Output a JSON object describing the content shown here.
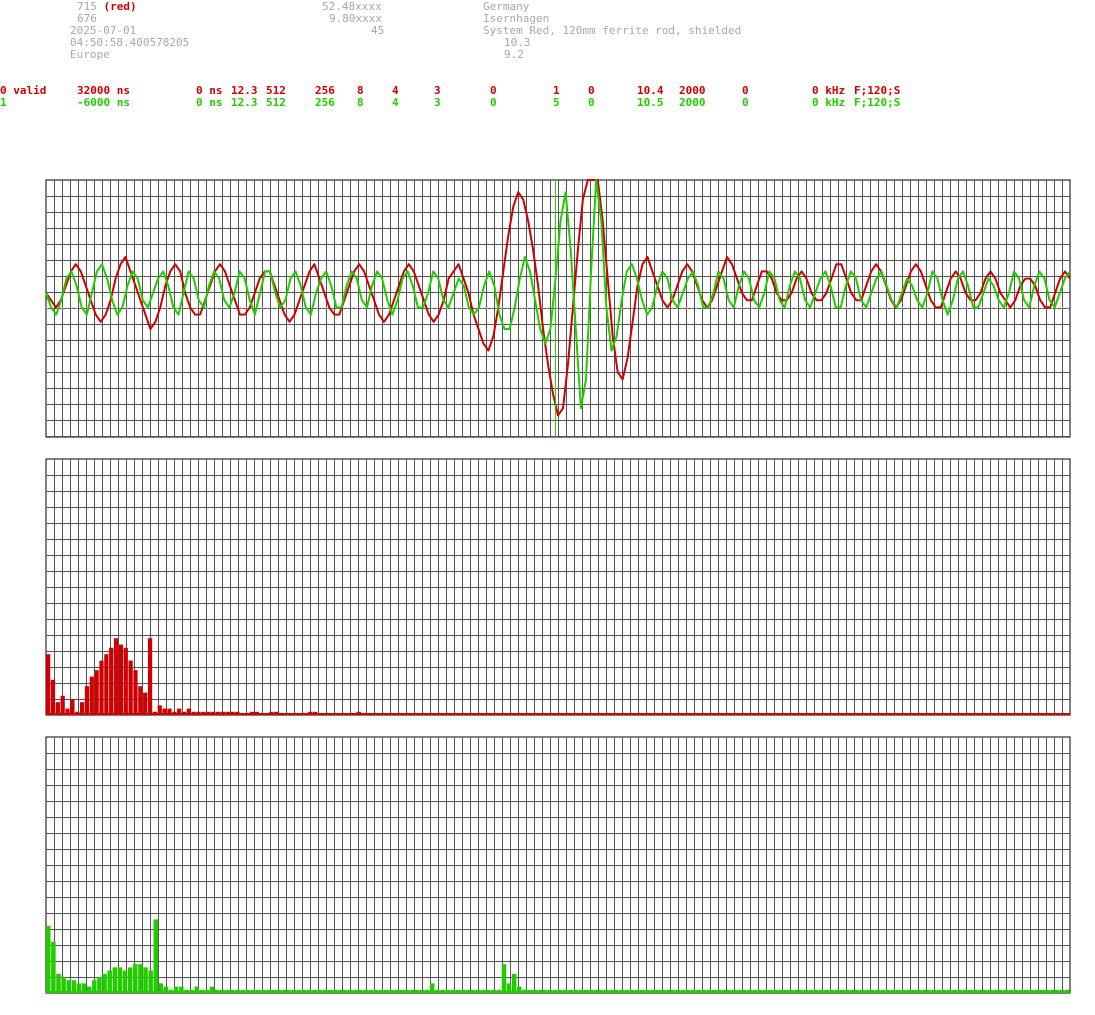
{
  "header": {
    "col1": [
      "715",
      "676",
      "2025-07-01",
      "04:50:58.400578205",
      "Europe"
    ],
    "col1_suffix": "(red)",
    "col2": [
      "52.48xxxx",
      "9.80xxxx",
      "45"
    ],
    "col3": [
      "Germany",
      "Isernhagen",
      "System Red, 120mm ferrite rod, shielded"
    ],
    "col3_extra": [
      "10.3",
      "9.2"
    ]
  },
  "channels": [
    {
      "color": "#d00000",
      "cells": [
        "0 valid",
        "32000 ns",
        "0 ns",
        "12.3",
        "512",
        "256",
        "8",
        "4",
        "3",
        "0",
        "1",
        "0",
        "10.4",
        "2000",
        "0",
        "0 kHz",
        "F;120;S"
      ]
    },
    {
      "color": "#22cc00",
      "cells": [
        "1",
        "-6000 ns",
        "0 ns",
        "12.3",
        "512",
        "256",
        "8",
        "4",
        "3",
        "0",
        "5",
        "0",
        "10.5",
        "2000",
        "0",
        "0 kHz",
        "F;120;S"
      ]
    }
  ],
  "chart_data": [
    {
      "type": "line",
      "series": [
        {
          "color": "#d00000",
          "values": [
            0,
            -1,
            -2,
            -1,
            1,
            3,
            4,
            3,
            1,
            -1,
            -3,
            -4,
            -3,
            -1,
            2,
            4,
            5,
            3,
            1,
            -1,
            -3,
            -5,
            -4,
            -2,
            1,
            3,
            4,
            3,
            0,
            -2,
            -3,
            -3,
            -1,
            1,
            3,
            4,
            3,
            1,
            -1,
            -3,
            -3,
            -2,
            0,
            2,
            3,
            3,
            1,
            -1,
            -3,
            -4,
            -3,
            -1,
            1,
            3,
            4,
            2,
            0,
            -2,
            -3,
            -3,
            -1,
            1,
            3,
            4,
            3,
            1,
            -1,
            -3,
            -4,
            -3,
            -1,
            1,
            3,
            4,
            3,
            1,
            -1,
            -3,
            -4,
            -3,
            -1,
            2,
            3,
            4,
            2,
            0,
            -3,
            -5,
            -7,
            -8,
            -6,
            -2,
            3,
            8,
            12,
            14,
            13,
            10,
            6,
            1,
            -5,
            -10,
            -14,
            -17,
            -16,
            -10,
            -2,
            6,
            13,
            17,
            18,
            16,
            10,
            2,
            -6,
            -11,
            -12,
            -9,
            -4,
            1,
            4,
            5,
            3,
            1,
            -1,
            -2,
            -1,
            1,
            3,
            4,
            3,
            1,
            -1,
            -2,
            -1,
            1,
            3,
            5,
            4,
            2,
            0,
            -1,
            -1,
            1,
            3,
            3,
            2,
            0,
            -1,
            -1,
            0,
            2,
            3,
            2,
            0,
            -1,
            -1,
            0,
            2,
            4,
            4,
            2,
            0,
            -1,
            -1,
            1,
            3,
            4,
            3,
            1,
            -1,
            -2,
            -1,
            1,
            3,
            4,
            3,
            1,
            -1,
            -2,
            -2,
            0,
            2,
            3,
            2,
            0,
            -1,
            -1,
            0,
            2,
            3,
            2,
            0,
            -1,
            -2,
            -1,
            1,
            2,
            2,
            1,
            -1,
            -2,
            -2,
            0,
            2,
            3,
            2
          ]
        },
        {
          "color": "#22cc00",
          "values": [
            0,
            -2,
            -3,
            -1,
            2,
            3,
            1,
            -2,
            -3,
            0,
            3,
            4,
            2,
            -1,
            -3,
            -2,
            1,
            3,
            2,
            -1,
            -2,
            0,
            2,
            3,
            1,
            -2,
            -3,
            0,
            3,
            2,
            -1,
            -2,
            1,
            3,
            2,
            -1,
            -2,
            0,
            3,
            2,
            -1,
            -3,
            0,
            3,
            3,
            0,
            -2,
            -1,
            2,
            3,
            1,
            -2,
            -3,
            0,
            2,
            3,
            1,
            -2,
            -2,
            1,
            3,
            2,
            -1,
            -2,
            1,
            3,
            2,
            -1,
            -3,
            -1,
            2,
            3,
            1,
            -2,
            -2,
            0,
            3,
            2,
            -1,
            -2,
            0,
            2,
            1,
            -2,
            -3,
            -2,
            1,
            3,
            1,
            -3,
            -5,
            -5,
            -2,
            2,
            5,
            3,
            -1,
            -5,
            -7,
            -5,
            2,
            10,
            14,
            6,
            -5,
            -16,
            -12,
            3,
            16,
            10,
            -2,
            -8,
            -6,
            -1,
            3,
            4,
            2,
            -1,
            -3,
            -2,
            1,
            3,
            2,
            -1,
            -2,
            0,
            2,
            3,
            1,
            -2,
            -2,
            0,
            3,
            2,
            -1,
            -2,
            1,
            3,
            2,
            -1,
            -2,
            0,
            3,
            2,
            -1,
            -2,
            1,
            3,
            2,
            -1,
            -2,
            0,
            2,
            3,
            1,
            -2,
            -2,
            1,
            3,
            2,
            -1,
            -2,
            0,
            2,
            3,
            1,
            -1,
            -2,
            0,
            2,
            1,
            -1,
            -2,
            0,
            3,
            2,
            -1,
            -3,
            -1,
            2,
            3,
            1,
            -2,
            -2,
            0,
            2,
            1,
            -1,
            -2,
            0,
            3,
            2,
            -1,
            -2,
            1,
            3,
            2,
            -1,
            -2,
            0,
            2,
            3
          ]
        }
      ]
    },
    {
      "type": "bar",
      "series": [
        {
          "color": "#d00000",
          "values": [
            19,
            11,
            4,
            6,
            2,
            5,
            1,
            4,
            9,
            12,
            14,
            17,
            19,
            21,
            24,
            22,
            21,
            17,
            14,
            9,
            7,
            24,
            1,
            3,
            2,
            2,
            1,
            2,
            1,
            2,
            1,
            1,
            1,
            1,
            1,
            1,
            1,
            1,
            1,
            1,
            0.5,
            0.5,
            1,
            1,
            0.5,
            0.5,
            1,
            1,
            0.5,
            0.5,
            0.5,
            0.5,
            0.5,
            0.5,
            1,
            1,
            0.5,
            0.5,
            0.5,
            0.5,
            0.5,
            0.5,
            0.5,
            0.5,
            1,
            0.5,
            0.5,
            0.5,
            0.5,
            0.5,
            0.5,
            0.5,
            0.5,
            0.5,
            0.5,
            0.5,
            0.5,
            0.5,
            0.5,
            0.5,
            0.5,
            0.5,
            0.5,
            0.5,
            0.5,
            0.5,
            0.5,
            0.5,
            0.5,
            0.5,
            0.5,
            0.5,
            0.5,
            0.5,
            0.5,
            0.5,
            0.5,
            0.5,
            0.5,
            0.5,
            0.5,
            0.5,
            0.5,
            0.5,
            0.5,
            0.5,
            0.5,
            0.5,
            0.5,
            0.5,
            0.5,
            0.5,
            0.5,
            0.5,
            0.5,
            0.5,
            0.5,
            0.5,
            0.5,
            0.5,
            0.5,
            0.5,
            0.5,
            0.5,
            0.5,
            0.5,
            0.5,
            0.5,
            0.5,
            0.5,
            0.5,
            0.5,
            0.5,
            0.5,
            0.5,
            0.5,
            0.5,
            0.5,
            0.5,
            0.5,
            0.5,
            0.5,
            0.5,
            0.5,
            0.5,
            0.5,
            0.5,
            0.5,
            0.5,
            0.5,
            0.5,
            0.5,
            0.5,
            0.5,
            0.5,
            0.5,
            0.5,
            0.5,
            0.5,
            0.5,
            0.5,
            0.5,
            0.5,
            0.5,
            0.5,
            0.5,
            0.5,
            0.5,
            0.5,
            0.5,
            0.5,
            0.5,
            0.5,
            0.5,
            0.5,
            0.5,
            0.5,
            0.5,
            0.5,
            0.5,
            0.5,
            0.5,
            0.5,
            0.5,
            0.5,
            0.5,
            0.5,
            0.5,
            0.5,
            0.5,
            0.5,
            0.5,
            0.5,
            0.5,
            0.5,
            0.5,
            0.5,
            0.5,
            0.5,
            0.5,
            0.5,
            0.5,
            0.5,
            0.5,
            0.5,
            0.5,
            0.5,
            0.5,
            0.5,
            0.5,
            0.5
          ]
        }
      ]
    },
    {
      "type": "bar",
      "series": [
        {
          "color": "#22cc00",
          "values": [
            21,
            16,
            6,
            5,
            4,
            4,
            3,
            3,
            2,
            4,
            5,
            6,
            7,
            8,
            8,
            7,
            8,
            9,
            9,
            8,
            7,
            23,
            3,
            2,
            1,
            2,
            2,
            1,
            1,
            2,
            1,
            1,
            2,
            1,
            1,
            1,
            1,
            1,
            1,
            1,
            1,
            1,
            1,
            1,
            1,
            1,
            1,
            1,
            1,
            1,
            1,
            1,
            1,
            1,
            1,
            1,
            1,
            1,
            1,
            1,
            1,
            1,
            1,
            1,
            1,
            1,
            1,
            1,
            1,
            1,
            1,
            1,
            1,
            1,
            1,
            3,
            1,
            1,
            1,
            1,
            1,
            1,
            1,
            1,
            1,
            1,
            1,
            1,
            1,
            9,
            3,
            6,
            2,
            1,
            1,
            1,
            1,
            1,
            1,
            1,
            1,
            1,
            1,
            1,
            1,
            1,
            1,
            1,
            1,
            1,
            1,
            1,
            1,
            1,
            1,
            1,
            1,
            1,
            1,
            1,
            1,
            1,
            1,
            1,
            1,
            1,
            1,
            1,
            1,
            1,
            1,
            1,
            1,
            1,
            1,
            1,
            1,
            1,
            1,
            1,
            1,
            1,
            1,
            1,
            1,
            1,
            1,
            1,
            1,
            1,
            1,
            1,
            1,
            1,
            1,
            1,
            1,
            1,
            1,
            1,
            1,
            1,
            1,
            1,
            1,
            1,
            1,
            1,
            1,
            1,
            1,
            1,
            1,
            1,
            1,
            1,
            1,
            1,
            1,
            1,
            1,
            1,
            1,
            1,
            1,
            1,
            1,
            1,
            1,
            1,
            1,
            1,
            1,
            1,
            1,
            1,
            1,
            1,
            1,
            1
          ]
        }
      ]
    }
  ]
}
